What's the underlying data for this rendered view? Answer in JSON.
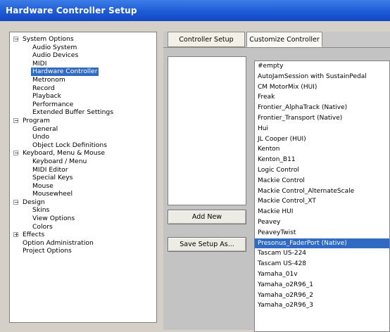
{
  "window": {
    "title": "Hardware Controller Setup"
  },
  "tree": {
    "nodes": [
      {
        "label": "System Options",
        "level": 0,
        "expander": "−"
      },
      {
        "label": "Audio System",
        "level": 1
      },
      {
        "label": "Audio Devices",
        "level": 1
      },
      {
        "label": "MIDI",
        "level": 1
      },
      {
        "label": "Hardware Controller",
        "level": 1,
        "selected": true
      },
      {
        "label": "Metronom",
        "level": 1
      },
      {
        "label": "Record",
        "level": 1
      },
      {
        "label": "Playback",
        "level": 1
      },
      {
        "label": "Performance",
        "level": 1
      },
      {
        "label": "Extended Buffer Settings",
        "level": 1
      },
      {
        "label": "Program",
        "level": 0,
        "expander": "−"
      },
      {
        "label": "General",
        "level": 1
      },
      {
        "label": "Undo",
        "level": 1
      },
      {
        "label": "Object Lock Definitions",
        "level": 1
      },
      {
        "label": "Keyboard, Menu & Mouse",
        "level": 0,
        "expander": "−"
      },
      {
        "label": "Keyboard / Menu",
        "level": 1
      },
      {
        "label": "MIDI Editor",
        "level": 1
      },
      {
        "label": "Special Keys",
        "level": 1
      },
      {
        "label": "Mouse",
        "level": 1
      },
      {
        "label": "Mousewheel",
        "level": 1
      },
      {
        "label": "Design",
        "level": 0,
        "expander": "−"
      },
      {
        "label": "Skins",
        "level": 1
      },
      {
        "label": "View Options",
        "level": 1
      },
      {
        "label": "Colors",
        "level": 1
      },
      {
        "label": "Effects",
        "level": 0,
        "expander": "+"
      },
      {
        "label": "Option Administration",
        "level": 0
      },
      {
        "label": "Project Options",
        "level": 0
      }
    ]
  },
  "tabs": [
    {
      "label": "Controller Setup",
      "active": false
    },
    {
      "label": "Customize Controller",
      "active": true
    }
  ],
  "buttons": {
    "add_new": "Add New",
    "save_setup_as": "Save Setup As..."
  },
  "controllers": {
    "items": [
      "#empty",
      "AutoJamSession with SustainPedal",
      "CM MotorMix (HUI)",
      "Freak",
      "Frontier_AlphaTrack (Native)",
      "Frontier_Transport (Native)",
      "Hui",
      "JL Cooper (HUI)",
      "Kenton",
      "Kenton_B11",
      "Logic Control",
      "Mackie Control",
      "Mackie Control_AlternateScale",
      "Mackie Control_XT",
      "Mackie HUI",
      "Peavey",
      "PeaveyTwist",
      "Presonus_FaderPort (Native)",
      "Tascam US-224",
      "Tascam US-428",
      "Yamaha_01v",
      "Yamaha_o2R96_1",
      "Yamaha_o2R96_2",
      "Yamaha_o2R96_3"
    ],
    "selected": "Presonus_FaderPort (Native)"
  },
  "colors": {
    "title_bar": "#1d5bd6",
    "selection": "#316ac5",
    "dialog_bg": "#d4d0c8"
  }
}
